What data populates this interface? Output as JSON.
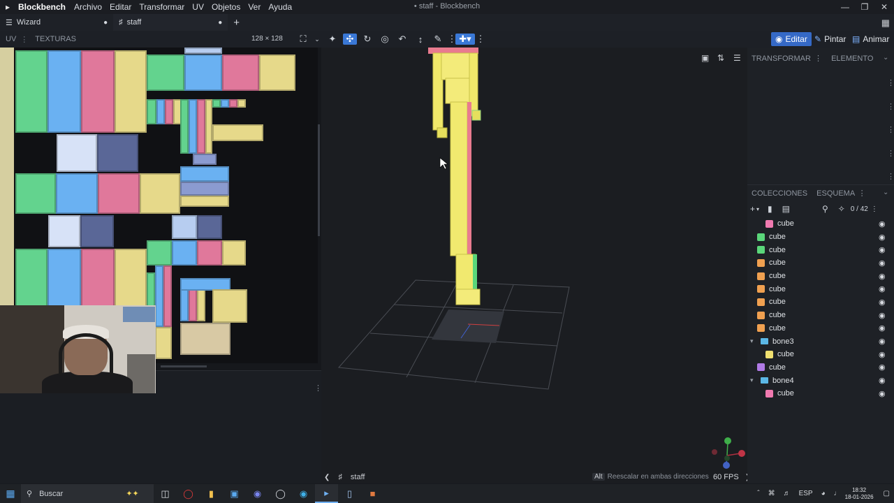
{
  "app": {
    "name": "Blockbench",
    "window_title": "• staff - Blockbench",
    "menu": [
      "Archivo",
      "Editar",
      "Transformar",
      "UV",
      "Objetos",
      "Ver",
      "Ayuda"
    ]
  },
  "tabs": [
    {
      "label": "Wizard"
    },
    {
      "label": "staff"
    }
  ],
  "uv_panel": {
    "tab_uv": "UV",
    "tab_textures": "TEXTURAS",
    "resolution": "128 × 128"
  },
  "modes": {
    "edit": "Editar",
    "paint": "Pintar",
    "animate": "Animar"
  },
  "right_panel": {
    "transform_tab": "TRANSFORMAR",
    "element_tab": "ELEMENTO",
    "collections_tab": "COLECCIONES",
    "outline_tab": "ESQUEMA",
    "counter": "0 / 42"
  },
  "outliner": [
    {
      "label": "cube",
      "color": "#f07ab0",
      "indent": 1,
      "type": "cube"
    },
    {
      "label": "cube",
      "color": "#5ad67a",
      "indent": 0,
      "type": "cube"
    },
    {
      "label": "cube",
      "color": "#5ad67a",
      "indent": 0,
      "type": "cube"
    },
    {
      "label": "cube",
      "color": "#f0a050",
      "indent": 0,
      "type": "cube"
    },
    {
      "label": "cube",
      "color": "#f0a050",
      "indent": 0,
      "type": "cube"
    },
    {
      "label": "cube",
      "color": "#f0a050",
      "indent": 0,
      "type": "cube"
    },
    {
      "label": "cube",
      "color": "#f0a050",
      "indent": 0,
      "type": "cube"
    },
    {
      "label": "cube",
      "color": "#f0a050",
      "indent": 0,
      "type": "cube"
    },
    {
      "label": "cube",
      "color": "#f0a050",
      "indent": 0,
      "type": "cube"
    },
    {
      "label": "bone3",
      "color": "#5bb7e6",
      "indent": 0,
      "type": "group"
    },
    {
      "label": "cube",
      "color": "#f0e070",
      "indent": 1,
      "type": "cube"
    },
    {
      "label": "cube",
      "color": "#b07ae6",
      "indent": 0,
      "type": "cube"
    },
    {
      "label": "bone4",
      "color": "#5bb7e6",
      "indent": 0,
      "type": "group"
    },
    {
      "label": "cube",
      "color": "#f07ab0",
      "indent": 1,
      "type": "cube"
    }
  ],
  "viewport": {
    "breadcrumb": "staff",
    "hint_key": "Alt",
    "hint_text": "Reescalar en ambas direcciones",
    "fps": "60 FPS"
  },
  "taskbar": {
    "search_placeholder": "Buscar",
    "language": "ESP",
    "time": "18:32",
    "date": "18-01-2026"
  }
}
